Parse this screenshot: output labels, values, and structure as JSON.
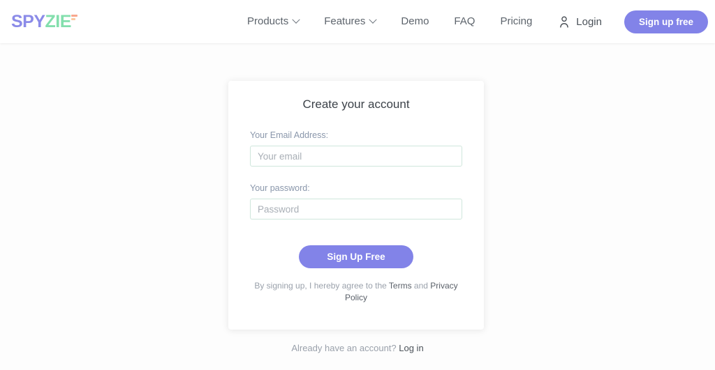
{
  "header": {
    "logo": {
      "part1": "SPY",
      "part2": "ZIE",
      "mark_icon": "trademark-bars-icon",
      "color1": "#8b8be8",
      "color2": "#83dfad",
      "mark_color": "#f8a78d"
    },
    "nav": [
      {
        "label": "Products",
        "has_caret": true
      },
      {
        "label": "Features",
        "has_caret": true
      },
      {
        "label": "Demo",
        "has_caret": false
      },
      {
        "label": "FAQ",
        "has_caret": false
      },
      {
        "label": "Pricing",
        "has_caret": false
      }
    ],
    "user_icon": "user-icon",
    "login_label": "Login",
    "signup_label": "Sign up free",
    "accent_color": "#8283e8"
  },
  "card": {
    "title": "Create your account",
    "email": {
      "label": "Your Email Address:",
      "placeholder": "Your email",
      "value": ""
    },
    "password": {
      "label": "Your password:",
      "placeholder": "Password",
      "value": ""
    },
    "submit_label": "Sign Up Free",
    "legal": {
      "prefix": "By signing up, I hereby agree to the ",
      "terms_link": "Terms",
      "middle": " and ",
      "privacy_link": "Privacy Policy"
    },
    "input_border_color": "#cfe6dc"
  },
  "footer": {
    "prompt": "Already have an account? ",
    "login_link": "Log in"
  }
}
